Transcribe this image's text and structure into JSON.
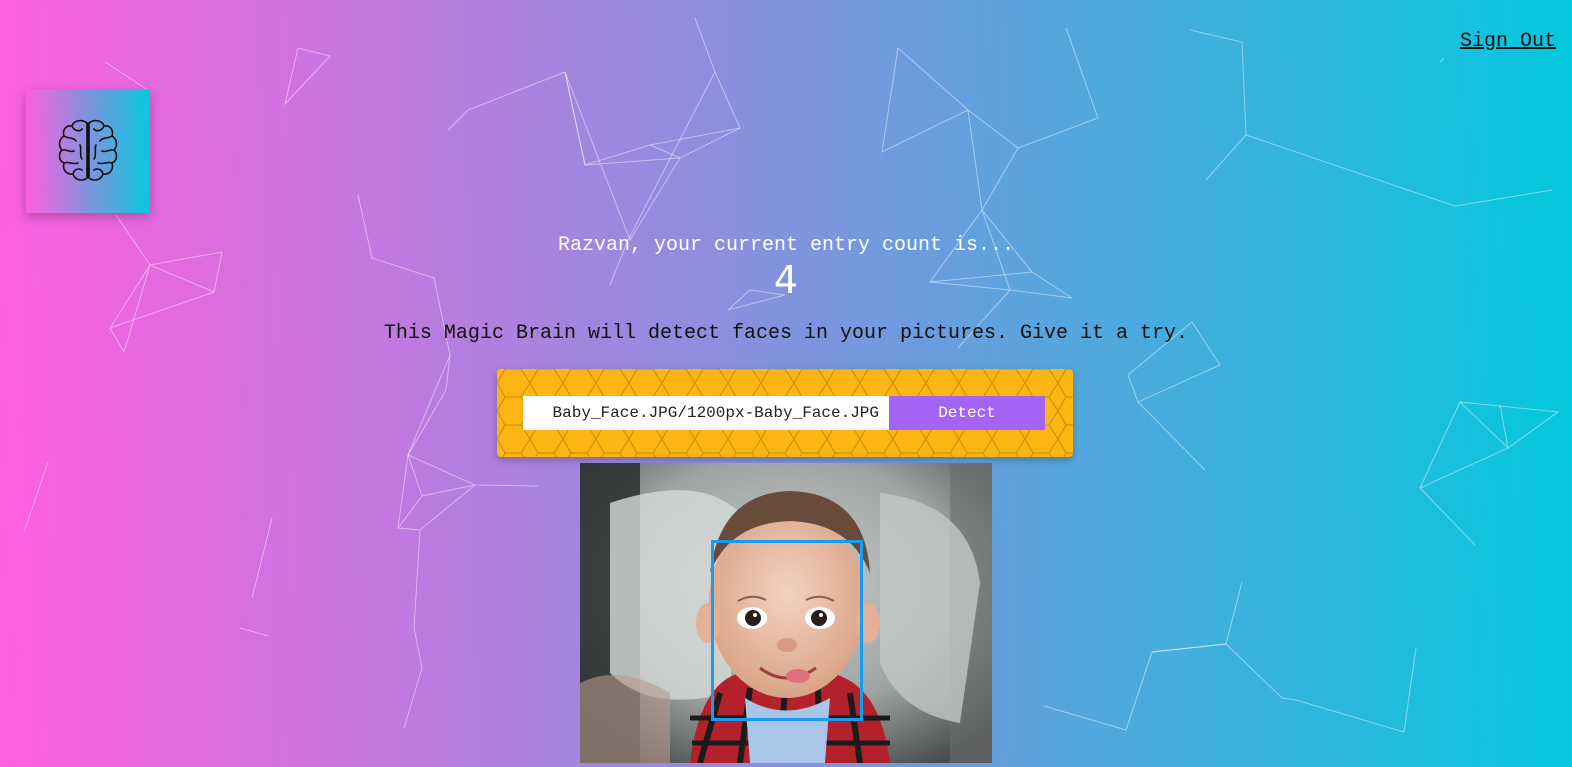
{
  "nav": {
    "signout_label": "Sign Out"
  },
  "logo": {
    "icon": "brain-icon"
  },
  "rank": {
    "message": "Razvan, your current entry count is...",
    "count": "4"
  },
  "intro": {
    "text": "This Magic Brain will detect faces in your pictures. Give it a try."
  },
  "form": {
    "url_value": "Baby_Face.JPG/1200px-Baby_Face.JPG",
    "detect_label": "Detect"
  },
  "colors": {
    "gradient_start": "#ff5edf",
    "gradient_end": "#04c8de",
    "form_background": "#fbb613",
    "detect_button": "#a463f2",
    "bounding_box": "#149df2"
  }
}
